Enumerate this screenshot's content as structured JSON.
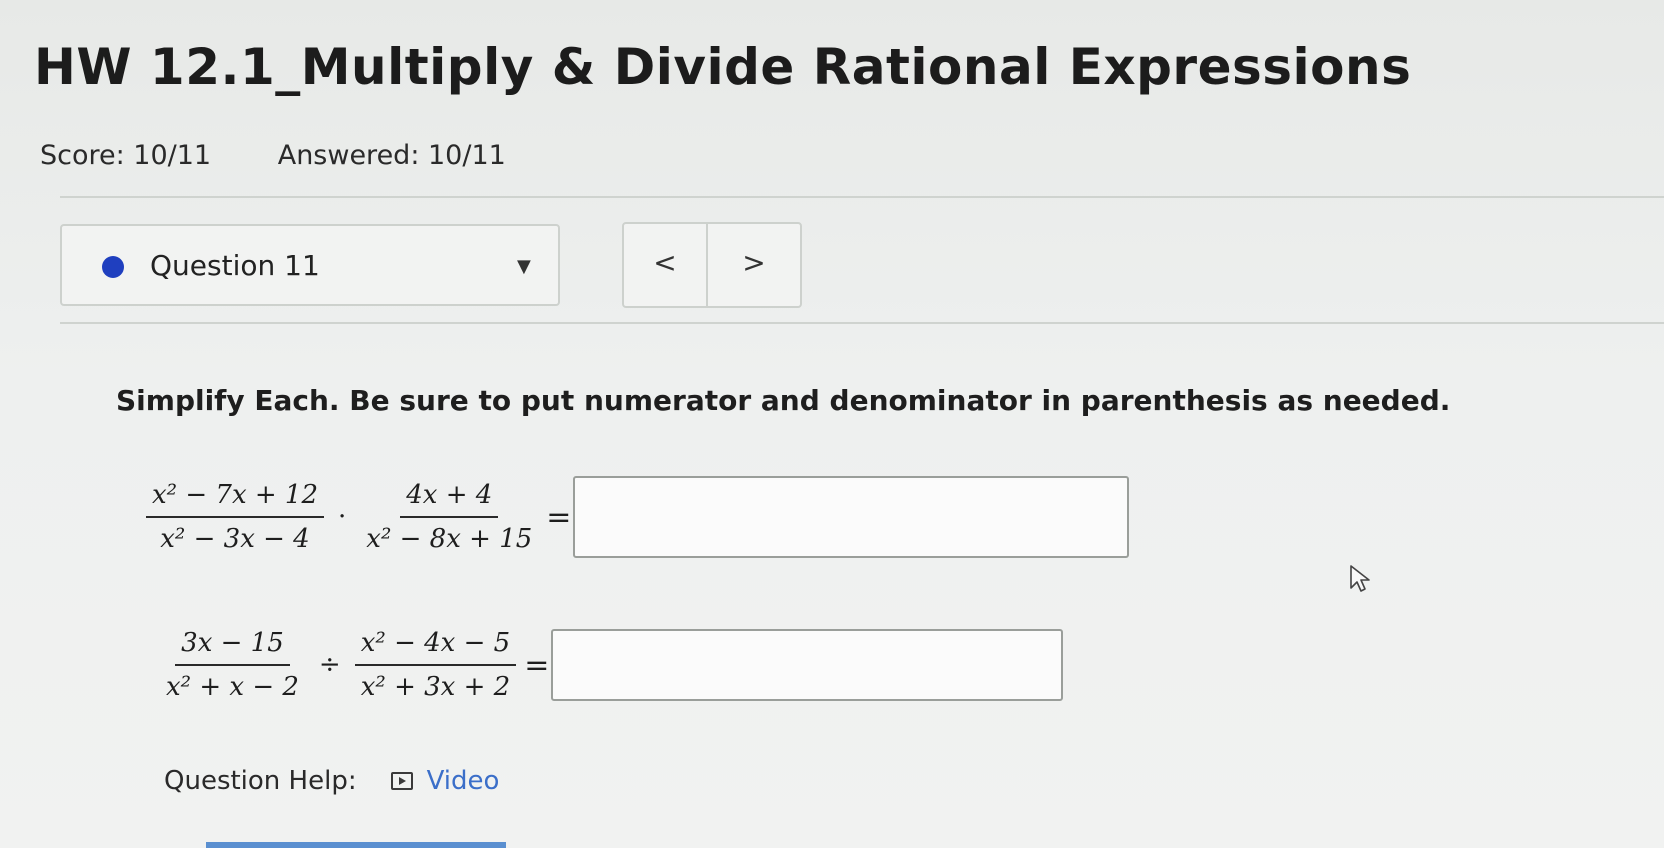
{
  "header": {
    "title": "HW 12.1_Multiply & Divide Rational Expressions",
    "score": "Score: 10/11",
    "answered": "Answered: 10/11"
  },
  "question_nav": {
    "label": "Question 11",
    "caret": "▼",
    "prev": "<",
    "next": ">",
    "status_color": "#1f3fbf"
  },
  "question": {
    "instructions": "Simplify Each. Be sure to put numerator and denominator in parenthesis as needed.",
    "problems": [
      {
        "left_num": "x² − 7x + 12",
        "left_den": "x² − 3x − 4",
        "operator": "·",
        "right_num": "4x + 4",
        "right_den": "x² − 8x + 15",
        "equals": "=",
        "answer": ""
      },
      {
        "left_num": "3x − 15",
        "left_den": "x² + x − 2",
        "operator": "÷",
        "right_num": "x² − 4x − 5",
        "right_den": "x² + 3x + 2",
        "equals": "=",
        "answer": ""
      }
    ]
  },
  "help": {
    "label": "Question Help:",
    "video_icon": "video-icon",
    "video_label": "Video",
    "link_color": "#3b6fc9"
  }
}
